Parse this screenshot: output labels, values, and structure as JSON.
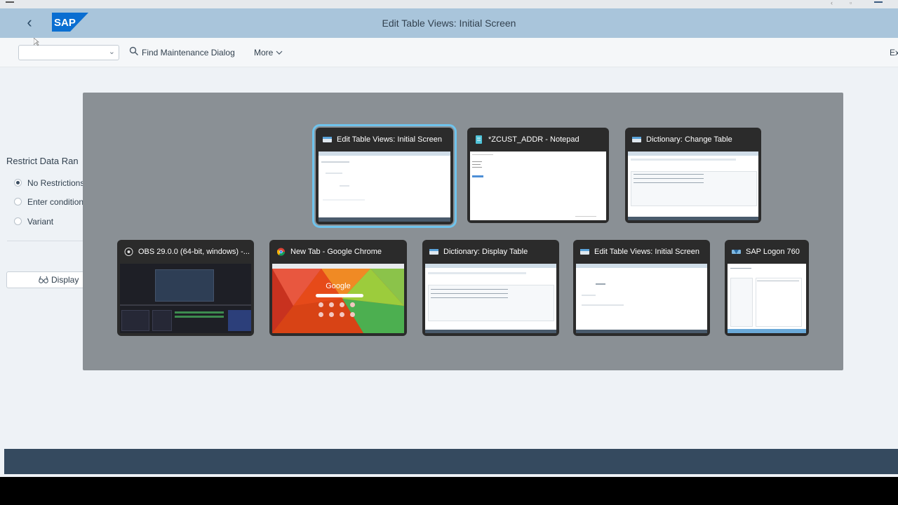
{
  "shell": {
    "title": "Edit Table Views: Initial Screen",
    "logo_text": "SAP",
    "brand_color": "#0a6ed1",
    "shellbar_color": "#a9c5db"
  },
  "toolbar": {
    "select_value": "",
    "find_label": "Find Maintenance Dialog",
    "more_label": "More",
    "exit_label": "Ex"
  },
  "form": {
    "section_title": "Restrict Data Ran",
    "options": [
      {
        "label": "No Restrictions",
        "selected": true
      },
      {
        "label": "Enter condition",
        "selected": false
      },
      {
        "label": "Variant",
        "selected": false
      }
    ],
    "display_label": "Display"
  },
  "task_switcher": {
    "windows": [
      {
        "title": "Edit Table Views: Initial Screen",
        "icon": "sap-gui-icon",
        "selected": true
      },
      {
        "title": "*ZCUST_ADDR - Notepad",
        "icon": "notepad-icon",
        "selected": false
      },
      {
        "title": "Dictionary: Change Table",
        "icon": "sap-gui-icon",
        "selected": false
      },
      {
        "title": "OBS 29.0.0 (64-bit, windows) -...",
        "icon": "obs-icon",
        "selected": false
      },
      {
        "title": "New Tab - Google Chrome",
        "icon": "chrome-icon",
        "selected": false
      },
      {
        "title": "Dictionary: Display Table",
        "icon": "sap-gui-icon",
        "selected": false
      },
      {
        "title": "Edit Table Views: Initial Screen",
        "icon": "sap-gui-icon",
        "selected": false
      },
      {
        "title": "SAP Logon 760",
        "icon": "sap-logon-icon",
        "selected": false
      }
    ],
    "chrome_preview_text": "Google"
  }
}
